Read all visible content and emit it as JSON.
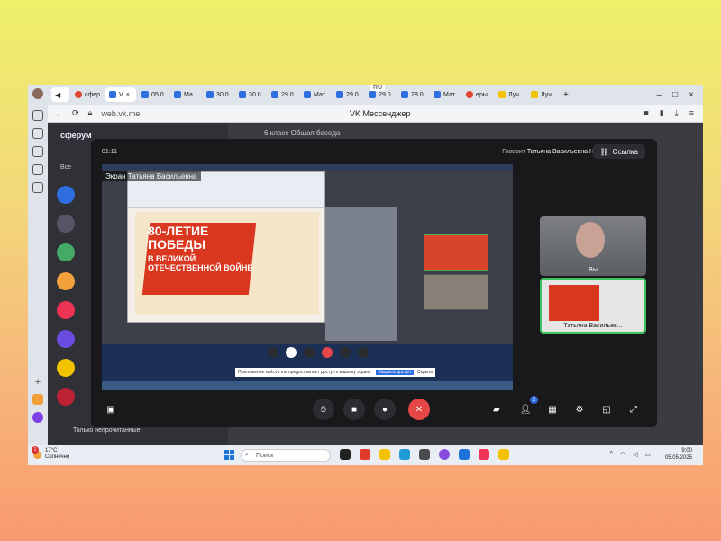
{
  "browser": {
    "ru_indicator": "RU",
    "tabs": [
      {
        "label": "сфер",
        "fav": "red"
      },
      {
        "label": "V",
        "fav": "blue",
        "active": true
      },
      {
        "label": "05.0",
        "fav": "blue"
      },
      {
        "label": "Ма",
        "fav": "blue"
      },
      {
        "label": "30.0",
        "fav": "blue"
      },
      {
        "label": "30.0",
        "fav": "blue"
      },
      {
        "label": "29.0",
        "fav": "blue"
      },
      {
        "label": "Мат",
        "fav": "blue"
      },
      {
        "label": "29.0",
        "fav": "blue"
      },
      {
        "label": "29.0",
        "fav": "blue"
      },
      {
        "label": "28.0",
        "fav": "blue"
      },
      {
        "label": "Мат",
        "fav": "blue"
      },
      {
        "label": "еры",
        "fav": "red"
      },
      {
        "label": "Луч",
        "fav": "yellow"
      },
      {
        "label": "Луч",
        "fav": "yellow"
      }
    ],
    "url": "web.vk.me",
    "page_title": "VK Мессенджер"
  },
  "vk": {
    "logo": "сферум",
    "chat_title": "6 класс Общая беседа",
    "filter_all": "Все",
    "only_unread": "Только непрочитанные"
  },
  "call": {
    "timer": "01:11",
    "speaker_prefix": "Говорит",
    "speaker_name": "Татьяна Васильевна Н.",
    "link_label": "Ссылка",
    "share_label": "Экран Татьяна Васильевна",
    "slide_title": "80-ЛЕТИЕ ПОБЕДЫ",
    "slide_subtitle": "В ВЕЛИКОЙ ОТЕЧЕСТВЕННОЙ ВОЙНЕ",
    "notice_text": "Приложение web.vk.me предоставляет доступ к вашему экрану.",
    "notice_stop": "Закрыть доступ",
    "notice_hide": "Скрыть",
    "tiles": [
      {
        "name": "Вы"
      },
      {
        "name": "Татьяна Васильев..."
      }
    ],
    "participants_badge": "2"
  },
  "taskbar": {
    "temperature": "17°C",
    "weather_desc": "Солнечно",
    "weather_badge": "1",
    "search_placeholder": "Поиск",
    "time": "9:00",
    "date": "05.05.2025"
  }
}
